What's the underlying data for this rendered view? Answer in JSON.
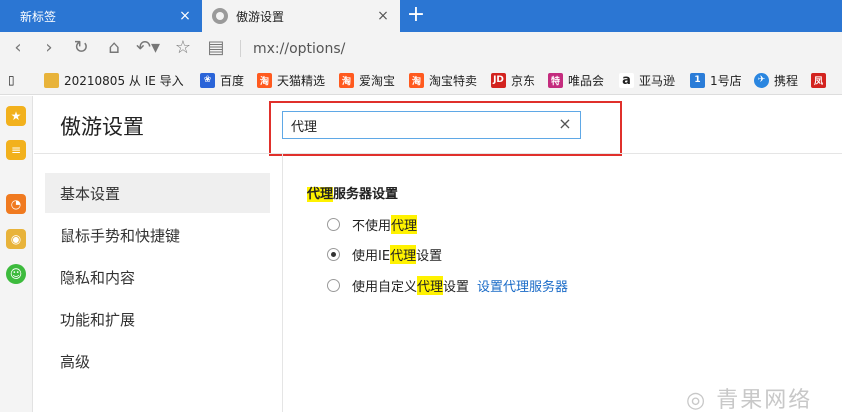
{
  "tabs": [
    {
      "label": "新标签",
      "active": false
    },
    {
      "label": "傲游设置",
      "active": true
    }
  ],
  "toolbar": {
    "url": "mx://options/"
  },
  "bookmarks": [
    {
      "label": "20210805 从 IE 导入",
      "icon": "folder-icon",
      "color": "#e8b33a"
    },
    {
      "label": "百度",
      "icon": "baidu-icon",
      "color": "#2a64d8"
    },
    {
      "label": "天猫精选",
      "icon": "taobao-icon",
      "color": "#ff5a1f"
    },
    {
      "label": "爱淘宝",
      "icon": "taobao-icon",
      "color": "#ff5a1f"
    },
    {
      "label": "淘宝特卖",
      "icon": "taobao-icon",
      "color": "#ff5a1f"
    },
    {
      "label": "京东",
      "icon": "jd-icon",
      "color": "#d3231f",
      "glyph": "JD"
    },
    {
      "label": "唯品会",
      "icon": "vip-icon",
      "color": "#c42c7e",
      "glyph": "特"
    },
    {
      "label": "亚马逊",
      "icon": "amazon-icon",
      "color": "#222222",
      "glyph": "a"
    },
    {
      "label": "1号店",
      "icon": "yhd-icon",
      "color": "#2a7cd8",
      "glyph": "1"
    },
    {
      "label": "携程",
      "icon": "ctrip-icon",
      "color": "#2a86e0"
    },
    {
      "label": "",
      "icon": "red-icon",
      "color": "#d3231f"
    }
  ],
  "settings": {
    "title": "傲游设置",
    "search_value": "代理",
    "nav": [
      {
        "label": "基本设置",
        "active": true
      },
      {
        "label": "鼠标手势和快捷键",
        "active": false
      },
      {
        "label": "隐私和内容",
        "active": false
      },
      {
        "label": "功能和扩展",
        "active": false
      },
      {
        "label": "高级",
        "active": false
      }
    ]
  },
  "proxy": {
    "title_highlight": "代理",
    "title_rest": "服务器设置",
    "options": [
      {
        "pre": "不使用",
        "highlight": "代理",
        "post": "",
        "checked": false
      },
      {
        "pre": "使用IE",
        "highlight": "代理",
        "post": "设置",
        "checked": true
      },
      {
        "pre": "使用自定义",
        "highlight": "代理",
        "post": "设置",
        "checked": false,
        "link": "设置代理服务器"
      }
    ]
  },
  "watermark": "青果网络",
  "colors": {
    "tabbar": "#2b76d3",
    "accent_link": "#1a6bc7",
    "highlight": "#fff200",
    "annotation_box": "#e0302b"
  }
}
